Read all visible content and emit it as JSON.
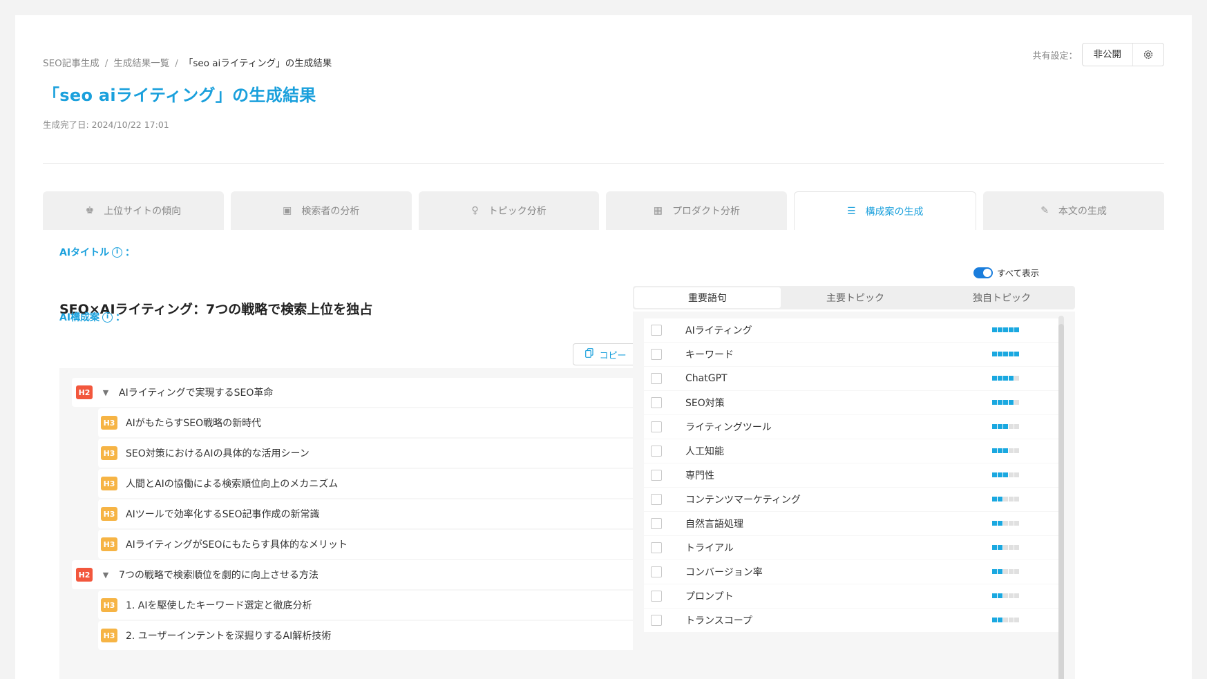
{
  "header": {
    "breadcrumb": [
      "SEO記事生成",
      "生成結果一覧",
      "「seo aiライティング」の生成結果"
    ],
    "breadcrumb_sep": "/",
    "title": "「seo aiライティング」の生成結果",
    "date": "生成完了日: 2024/10/22 17:01",
    "share_label": "共有設定：",
    "share_value": "非公開",
    "share_icon": "gear-icon"
  },
  "tabs": [
    {
      "label": "上位サイトの傾向",
      "icon": "crown-icon"
    },
    {
      "label": "検索者の分析",
      "icon": "calendar-user-icon"
    },
    {
      "label": "トピック分析",
      "icon": "lightbulb-icon"
    },
    {
      "label": "プロダクト分析",
      "icon": "grid-icon"
    },
    {
      "label": "構成案の生成",
      "icon": "list-icon",
      "active": true
    },
    {
      "label": "本文の生成",
      "icon": "pencil-icon"
    }
  ],
  "ai_title": {
    "label": "AIタイトル",
    "colon": "：",
    "value": "SEO×AIライティング：7つの戦略で検索上位を独占"
  },
  "outline": {
    "label": "AI構成案",
    "colon": "：",
    "copy_label": "コピー",
    "items": [
      {
        "level": "H2",
        "text": "AIライティングで実現するSEO革命"
      },
      {
        "level": "H3",
        "text": "AIがもたらすSEO戦略の新時代"
      },
      {
        "level": "H3",
        "text": "SEO対策におけるAIの具体的な活用シーン"
      },
      {
        "level": "H3",
        "text": "人間とAIの協働による検索順位向上のメカニズム"
      },
      {
        "level": "H3",
        "text": "AIツールで効率化するSEO記事作成の新常識"
      },
      {
        "level": "H3",
        "text": "AIライティングがSEOにもたらす具体的なメリット"
      },
      {
        "level": "H2",
        "text": "7つの戦略で検索順位を劇的に向上させる方法"
      },
      {
        "level": "H3",
        "text": "1. AIを駆使したキーワード選定と徹底分析"
      },
      {
        "level": "H3",
        "text": "2. ユーザーインテントを深掘りするAI解析技術"
      }
    ]
  },
  "right_panel": {
    "toggle_label": "すべて表示",
    "toggle_on": true,
    "seg_tabs": [
      "重要語句",
      "主要トピック",
      "独自トピック"
    ],
    "active_seg": 0,
    "keywords": [
      {
        "label": "AIライティング",
        "level": 5
      },
      {
        "label": "キーワード",
        "level": 5
      },
      {
        "label": "ChatGPT",
        "level": 4
      },
      {
        "label": "SEO対策",
        "level": 4
      },
      {
        "label": "ライティングツール",
        "level": 3
      },
      {
        "label": "人工知能",
        "level": 3
      },
      {
        "label": "専門性",
        "level": 3
      },
      {
        "label": "コンテンツマーケティング",
        "level": 2
      },
      {
        "label": "自然言語処理",
        "level": 2
      },
      {
        "label": "トライアル",
        "level": 2
      },
      {
        "label": "コンバージョン率",
        "level": 2
      },
      {
        "label": "プロンプト",
        "level": 2
      },
      {
        "label": "トランスコープ",
        "level": 2
      }
    ],
    "level_max": 5
  },
  "colors": {
    "accent": "#1aa0dc",
    "h2_badge": "#f2573d",
    "h3_badge": "#f6b445",
    "bar_on": "#1aa8e0"
  }
}
